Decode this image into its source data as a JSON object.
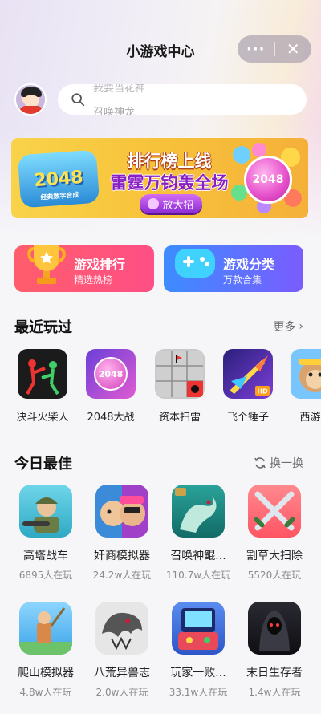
{
  "header": {
    "title": "小游戏中心",
    "more_label": "···",
    "close_label": "✕"
  },
  "search": {
    "hint_top": "我要当花神",
    "hint_bottom": "召唤神龙"
  },
  "banner": {
    "logo": "2048",
    "logo_sub": "经典数字合成",
    "line1": "排行榜上线",
    "line2": "雷霆万钧轰全场",
    "button": "放大招",
    "ball_label": "2048"
  },
  "features": [
    {
      "title": "游戏排行",
      "subtitle": "精选热榜"
    },
    {
      "title": "游戏分类",
      "subtitle": "万款合集"
    }
  ],
  "recent": {
    "title": "最近玩过",
    "more": "更多",
    "items": [
      {
        "name": "决斗火柴人",
        "icon": "stickman-icon",
        "color": "#1b1b1b"
      },
      {
        "name": "2048大战",
        "icon": "2048-ball-icon",
        "color": "#a34bd6"
      },
      {
        "name": "资本扫雷",
        "icon": "minesweeper-icon",
        "color": "#c9c9c9"
      },
      {
        "name": "飞个锤子",
        "icon": "jet-icon",
        "color": "#3a2b8f"
      },
      {
        "name": "西游梗",
        "icon": "monkey-icon",
        "color": "#79c6ff"
      }
    ]
  },
  "best": {
    "title": "今日最佳",
    "refresh": "换一换",
    "items": [
      {
        "name": "高塔战车",
        "count": "6895人在玩",
        "icon": "soldier-icon",
        "color": "#4fc2d9"
      },
      {
        "name": "奸商模拟器",
        "count": "24.2w人在玩",
        "icon": "merchant-icon",
        "color": "#8a5ad8"
      },
      {
        "name": "召唤神鲲...",
        "count": "110.7w人在玩",
        "icon": "dragon-icon",
        "color": "#1f8f87"
      },
      {
        "name": "割草大扫除",
        "count": "5520人在玩",
        "icon": "swords-icon",
        "color": "#ff6f77"
      },
      {
        "name": "爬山模拟器",
        "count": "4.8w人在玩",
        "icon": "climber-icon",
        "color": "#5bb9f0"
      },
      {
        "name": "八荒异兽志",
        "count": "2.0w人在玩",
        "icon": "beast-icon",
        "color": "#d9d9d9"
      },
      {
        "name": "玩家一败...",
        "count": "33.1w人在玩",
        "icon": "arcade-icon",
        "color": "#4a7be0"
      },
      {
        "name": "末日生存者",
        "count": "1.4w人在玩",
        "icon": "reaper-icon",
        "color": "#1a1a1f"
      }
    ]
  }
}
